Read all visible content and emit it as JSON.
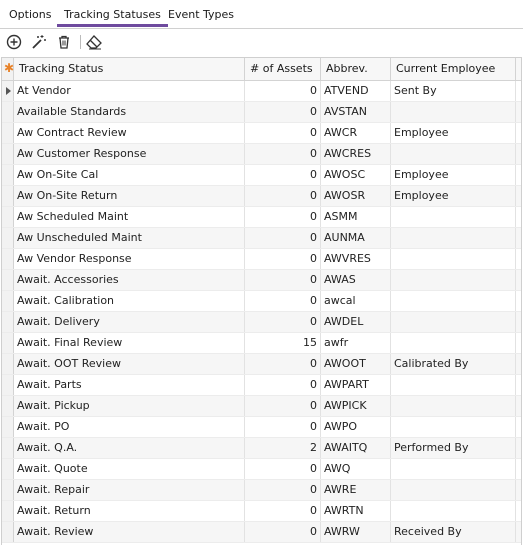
{
  "tabs": [
    {
      "label": "Options"
    },
    {
      "label": "Tracking Statuses"
    },
    {
      "label": "Event Types"
    }
  ],
  "active_tab": "Tracking Statuses",
  "toolbar": {
    "buttons": [
      "add-icon",
      "magic-wand-icon",
      "delete-icon",
      "eraser-icon"
    ]
  },
  "colors": {
    "accent": "#6e4a9e",
    "new_row_marker": "#e8832a"
  },
  "grid": {
    "new_row_marker": "✱",
    "columns": [
      "Tracking Status",
      "# of Assets",
      "Abbrev.",
      "Current Employee"
    ],
    "rows": [
      {
        "status": "At Vendor",
        "assets": "0",
        "abbrev": "ATVEND",
        "employee": "Sent By"
      },
      {
        "status": "Available Standards",
        "assets": "0",
        "abbrev": "AVSTAN",
        "employee": ""
      },
      {
        "status": "Aw Contract Review",
        "assets": "0",
        "abbrev": "AWCR",
        "employee": "Employee"
      },
      {
        "status": "Aw Customer Response",
        "assets": "0",
        "abbrev": "AWCRES",
        "employee": ""
      },
      {
        "status": "Aw On-Site Cal",
        "assets": "0",
        "abbrev": "AWOSC",
        "employee": "Employee"
      },
      {
        "status": "Aw On-Site Return",
        "assets": "0",
        "abbrev": "AWOSR",
        "employee": "Employee"
      },
      {
        "status": "Aw Scheduled Maint",
        "assets": "0",
        "abbrev": "ASMM",
        "employee": ""
      },
      {
        "status": "Aw Unscheduled Maint",
        "assets": "0",
        "abbrev": "AUNMA",
        "employee": ""
      },
      {
        "status": "Aw Vendor Response",
        "assets": "0",
        "abbrev": "AWVRES",
        "employee": ""
      },
      {
        "status": "Await. Accessories",
        "assets": "0",
        "abbrev": "AWAS",
        "employee": ""
      },
      {
        "status": "Await. Calibration",
        "assets": "0",
        "abbrev": "awcal",
        "employee": ""
      },
      {
        "status": "Await. Delivery",
        "assets": "0",
        "abbrev": "AWDEL",
        "employee": ""
      },
      {
        "status": "Await. Final Review",
        "assets": "15",
        "abbrev": "awfr",
        "employee": ""
      },
      {
        "status": "Await. OOT Review",
        "assets": "0",
        "abbrev": "AWOOT",
        "employee": "Calibrated By"
      },
      {
        "status": "Await. Parts",
        "assets": "0",
        "abbrev": "AWPART",
        "employee": ""
      },
      {
        "status": "Await. Pickup",
        "assets": "0",
        "abbrev": "AWPICK",
        "employee": ""
      },
      {
        "status": "Await. PO",
        "assets": "0",
        "abbrev": "AWPO",
        "employee": ""
      },
      {
        "status": "Await. Q.A.",
        "assets": "2",
        "abbrev": "AWAITQ",
        "employee": "Performed By"
      },
      {
        "status": "Await. Quote",
        "assets": "0",
        "abbrev": "AWQ",
        "employee": ""
      },
      {
        "status": "Await. Repair",
        "assets": "0",
        "abbrev": "AWRE",
        "employee": ""
      },
      {
        "status": "Await. Return",
        "assets": "0",
        "abbrev": "AWRTN",
        "employee": ""
      },
      {
        "status": "Await. Review",
        "assets": "0",
        "abbrev": "AWRW",
        "employee": "Received By"
      }
    ]
  }
}
